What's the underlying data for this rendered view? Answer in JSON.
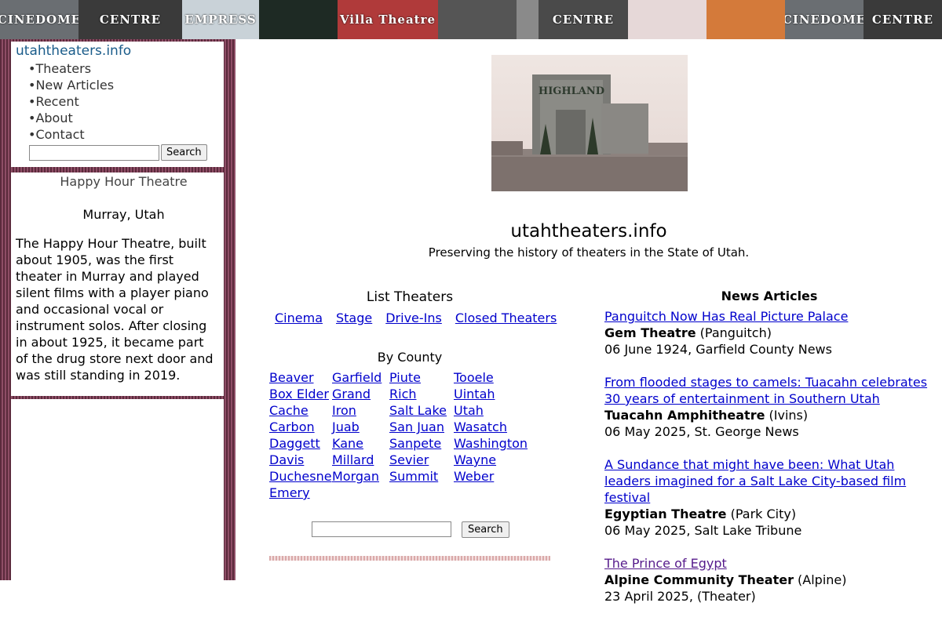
{
  "banner": {
    "tiles": [
      {
        "name": "cinedome",
        "text": "CINEDOME",
        "bg": "#6a6e72",
        "w": 100
      },
      {
        "name": "centre",
        "text": "CENTRE",
        "bg": "#3a3a3a",
        "w": 132
      },
      {
        "name": "empress",
        "text": "EMPRESS",
        "bg": "#c9d2d8",
        "w": 98
      },
      {
        "name": "screen",
        "text": "",
        "bg": "#1e2a24",
        "w": 100
      },
      {
        "name": "villa",
        "text": "Villa Theatre",
        "bg": "#b03a3a",
        "w": 128
      },
      {
        "name": "dome-interior",
        "text": "",
        "bg": "#555555",
        "w": 100
      },
      {
        "name": "tower",
        "text": "",
        "bg": "#8a8a8a",
        "w": 28
      },
      {
        "name": "centre-marquee",
        "text": "CENTRE",
        "bg": "#4a4a4a",
        "w": 114
      },
      {
        "name": "curtain",
        "text": "",
        "bg": "#e6d8d8",
        "w": 100
      },
      {
        "name": "cinemark",
        "text": "",
        "bg": "#d47a3a",
        "w": 100
      },
      {
        "name": "cinedome-2",
        "text": "CINEDOME",
        "bg": "#6a6e72",
        "w": 100
      },
      {
        "name": "centre-2",
        "text": "CENTRE",
        "bg": "#3a3a3a",
        "w": 100
      }
    ]
  },
  "sidebar": {
    "site_link": "utahtheaters.info",
    "menu": [
      "Theaters",
      "New Articles",
      "Recent",
      "About",
      "Contact"
    ],
    "search_button": "Search"
  },
  "theater_info": {
    "name": "Happy Hour Theatre",
    "location": "Murray, Utah",
    "description": "The Happy Hour Theatre, built about 1905, was the first theater in Murray and played silent films with a player piano and occasional vocal or instrument solos.  After closing in about 1925, it became part of the drug store next door and was still standing in 2019."
  },
  "hero": {
    "sign_text": "HIGHLAND"
  },
  "header": {
    "title": "utahtheaters.info",
    "tagline": "Preserving the history of theaters in the State of Utah."
  },
  "list_theaters": {
    "heading": "List Theaters",
    "types": [
      "Cinema",
      "Stage",
      "Drive-Ins",
      "Closed Theaters"
    ],
    "county_heading": "By County",
    "county_columns": [
      [
        "Beaver",
        "Box Elder",
        "Cache",
        "Carbon",
        "Daggett",
        "Davis",
        "Duchesne",
        "Emery"
      ],
      [
        "Garfield",
        "Grand",
        "Iron",
        "Juab",
        "Kane",
        "Millard",
        "Morgan"
      ],
      [
        "Piute",
        "Rich",
        "Salt Lake",
        "San Juan",
        "Sanpete",
        "Sevier",
        "Summit"
      ],
      [
        "Tooele",
        "Uintah",
        "Utah",
        "Wasatch",
        "Washington",
        "Wayne",
        "Weber"
      ]
    ],
    "search_button": "Search"
  },
  "news": {
    "heading": "News Articles",
    "items": [
      {
        "title": "Panguitch Now Has Real Picture Palace",
        "theater": "Gem Theatre",
        "place": "(Panguitch)",
        "source": "06 June 1924, Garfield County News",
        "visited": false
      },
      {
        "title": "From flooded stages to camels: Tuacahn celebrates 30 years of entertainment in Southern Utah",
        "theater": "Tuacahn Amphitheatre",
        "place": "(Ivins)",
        "source": "06 May 2025, St. George News",
        "visited": false
      },
      {
        "title": "A Sundance that might have been: What Utah leaders imagined for a Salt Lake City-based film festival",
        "theater": "Egyptian Theatre",
        "place": "(Park City)",
        "source": "06 May 2025, Salt Lake Tribune",
        "visited": false
      },
      {
        "title": "The Prince of Egypt",
        "theater": "Alpine Community Theater",
        "place": "(Alpine)",
        "source": "23 April 2025, (Theater)",
        "visited": true
      }
    ]
  }
}
